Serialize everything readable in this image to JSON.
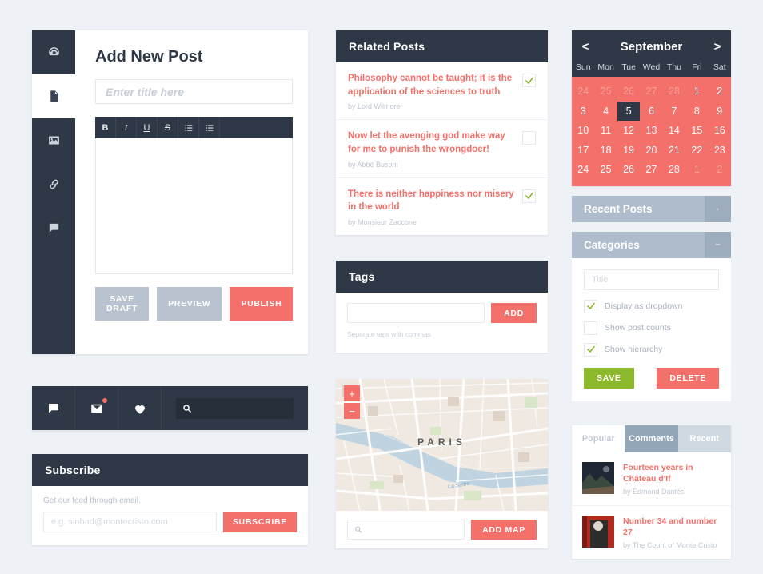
{
  "editor": {
    "rail": [
      {
        "name": "dashboard-icon",
        "active": false
      },
      {
        "name": "document-icon",
        "active": true
      },
      {
        "name": "image-icon",
        "active": false
      },
      {
        "name": "link-icon",
        "active": false
      },
      {
        "name": "comment-icon",
        "active": false
      }
    ],
    "heading": "Add New Post",
    "title_placeholder": "Enter title here",
    "title_value": "",
    "toolbar": [
      "B",
      "I",
      "U",
      "S",
      "unordered-list-icon",
      "ordered-list-icon"
    ],
    "content_value": "",
    "buttons": {
      "save_draft": "SAVE DRAFT",
      "preview": "PREVIEW",
      "publish": "PUBLISH"
    }
  },
  "socialbar": {
    "icons": [
      "comment-icon",
      "mail-icon",
      "heart-icon"
    ],
    "mail_has_badge": true,
    "search_placeholder": "",
    "search_value": ""
  },
  "subscribe": {
    "title": "Subscribe",
    "note": "Get our feed through email.",
    "email_placeholder": "e.g. sinbad@montecristo.com",
    "email_value": "",
    "button": "SUBSCRIBE"
  },
  "related_posts": {
    "title": "Related Posts",
    "items": [
      {
        "title": "Philosophy cannot be taught; it is the application of the sciences to truth",
        "by": "by Lord Wilmore",
        "checked": true
      },
      {
        "title": "Now let the avenging god make way for me to punish the wrongdoer!",
        "by": "by Abbé Busoni",
        "checked": false
      },
      {
        "title": "There is neither happiness nor misery in the world",
        "by": "by Monsieur Zaccone",
        "checked": true
      }
    ]
  },
  "tags": {
    "title": "Tags",
    "input_value": "",
    "input_placeholder": "",
    "add_button": "ADD",
    "hint": "Separate tags with commas"
  },
  "map": {
    "zoom_in": "+",
    "zoom_out": "−",
    "city_label": "PARIS",
    "river_label": "La Seine",
    "search_value": "",
    "search_placeholder": "",
    "add_button": "ADD MAP"
  },
  "calendar": {
    "prev": "<",
    "next": ">",
    "month": "September",
    "dow": [
      "Sun",
      "Mon",
      "Tue",
      "Wed",
      "Thu",
      "Fri",
      "Sat"
    ],
    "days": [
      {
        "d": "24",
        "mute": true
      },
      {
        "d": "25",
        "mute": true
      },
      {
        "d": "26",
        "mute": true
      },
      {
        "d": "27",
        "mute": true
      },
      {
        "d": "28",
        "mute": true
      },
      {
        "d": "1"
      },
      {
        "d": "2"
      },
      {
        "d": "3"
      },
      {
        "d": "4"
      },
      {
        "d": "5",
        "selected": true
      },
      {
        "d": "6"
      },
      {
        "d": "7"
      },
      {
        "d": "8"
      },
      {
        "d": "9"
      },
      {
        "d": "10"
      },
      {
        "d": "11"
      },
      {
        "d": "12"
      },
      {
        "d": "13"
      },
      {
        "d": "14"
      },
      {
        "d": "15"
      },
      {
        "d": "16"
      },
      {
        "d": "17"
      },
      {
        "d": "18"
      },
      {
        "d": "19"
      },
      {
        "d": "20"
      },
      {
        "d": "21"
      },
      {
        "d": "22"
      },
      {
        "d": "23"
      },
      {
        "d": "24"
      },
      {
        "d": "25"
      },
      {
        "d": "26"
      },
      {
        "d": "27"
      },
      {
        "d": "28"
      },
      {
        "d": "1",
        "mute": true
      },
      {
        "d": "2",
        "mute": true
      }
    ]
  },
  "recent_posts_widget": {
    "title": "Recent Posts",
    "toggle": "·",
    "expanded": false
  },
  "categories_widget": {
    "title": "Categories",
    "toggle": "−",
    "expanded": true,
    "title_placeholder": "Title",
    "title_value": "",
    "options": [
      {
        "label": "Display as dropdown",
        "checked": true
      },
      {
        "label": "Show post counts",
        "checked": false
      },
      {
        "label": "Show hierarchy",
        "checked": true
      }
    ],
    "save_button": "SAVE",
    "delete_button": "DELETE"
  },
  "tabs_widget": {
    "tabs": [
      {
        "label": "Popular",
        "state": "white"
      },
      {
        "label": "Comments",
        "state": "active"
      },
      {
        "label": "Recent",
        "state": "light"
      }
    ],
    "posts": [
      {
        "title": "Fourteen years in Château d'If",
        "by": "by Edmond Dantès"
      },
      {
        "title": "Number 34 and number 27",
        "by": "by The Count of Monte Cristo"
      }
    ]
  },
  "colors": {
    "background": "#eef1f6",
    "dark": "#2f3846",
    "red": "#f4706a",
    "green": "#8cb82b",
    "grey_button": "#b9c3cf",
    "slate": "#aebccb"
  }
}
